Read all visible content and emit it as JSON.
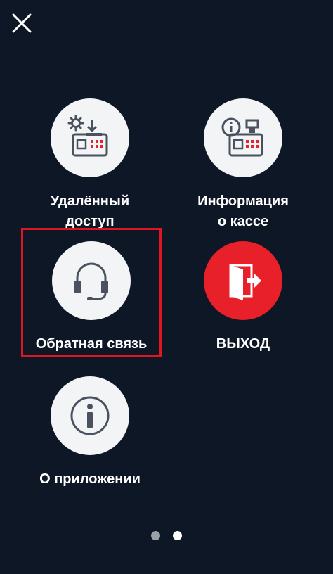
{
  "menu": {
    "items": [
      {
        "id": "remote",
        "label": "Удалённый\nдоступ",
        "icon": "remote-access-register-icon"
      },
      {
        "id": "info",
        "label": "Информация\nо кассе",
        "icon": "register-info-icon"
      },
      {
        "id": "feedback",
        "label": "Обратная связь",
        "icon": "headset-icon",
        "highlighted": true
      },
      {
        "id": "exit",
        "label": "ВЫХОД",
        "icon": "exit-door-icon"
      },
      {
        "id": "about",
        "label": "О приложении",
        "icon": "info-circle-icon"
      }
    ]
  },
  "close": {
    "icon": "close-icon"
  },
  "pager": {
    "count": 2,
    "active": 1
  },
  "colors": {
    "background": "#0e1726",
    "circle": "#f3f4f6",
    "icon_gray": "#4a5260",
    "accent_red": "#e8202a",
    "dot_inactive": "#9aa0a8",
    "dot_active": "#ffffff"
  }
}
